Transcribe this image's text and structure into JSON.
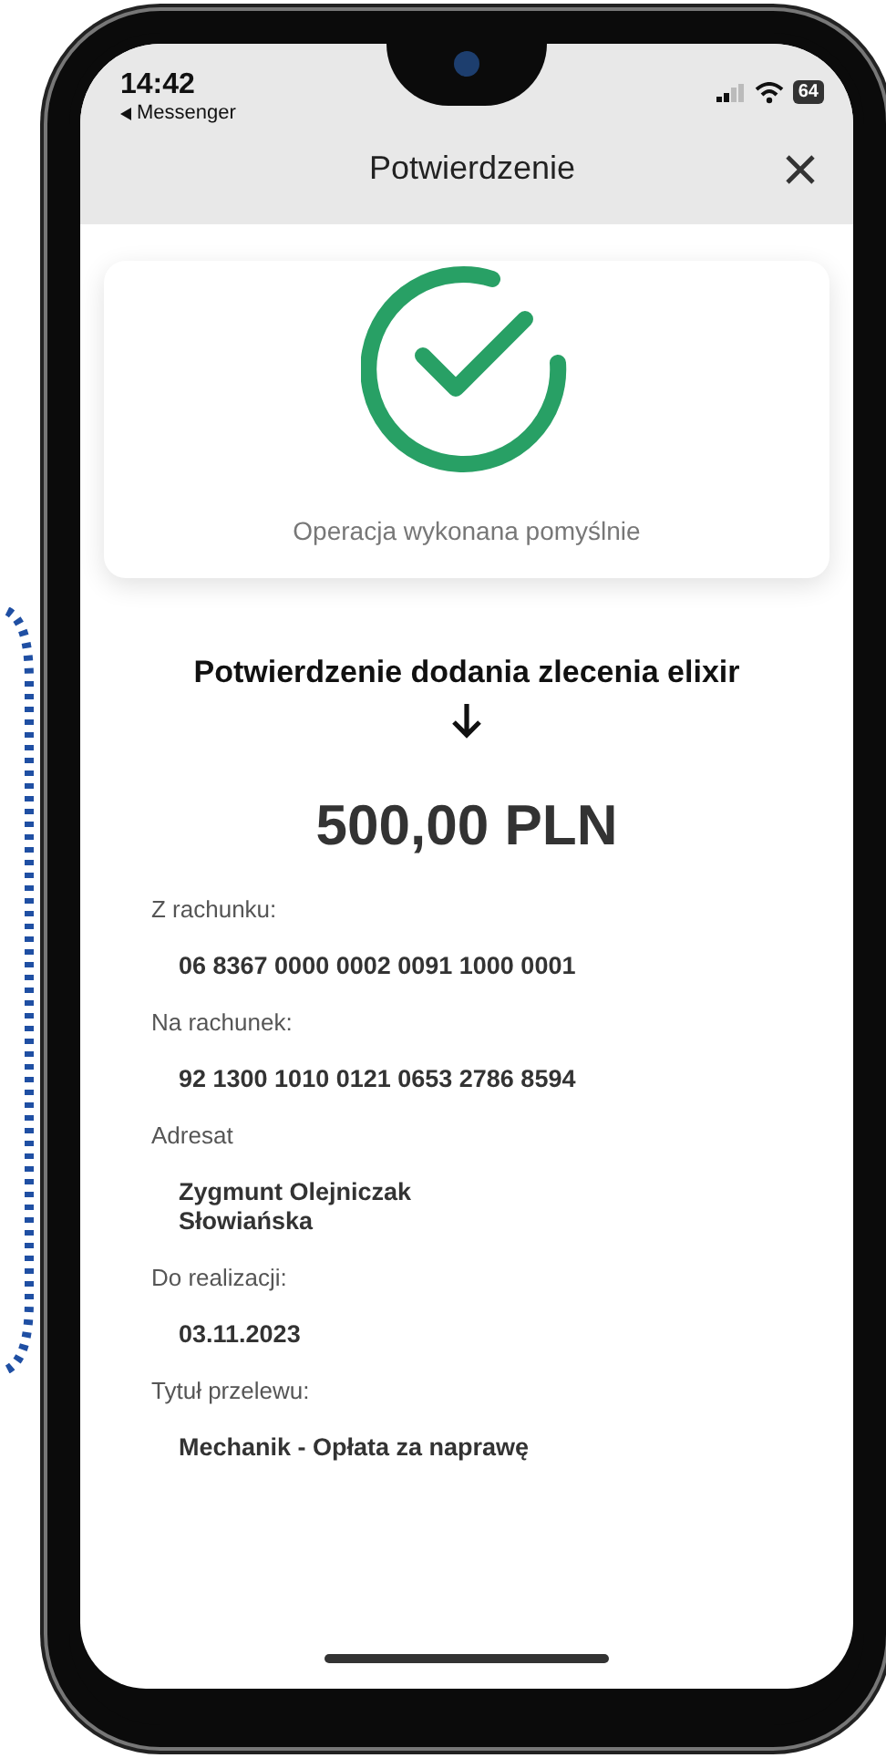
{
  "status_bar": {
    "time": "14:42",
    "back_label": "Messenger",
    "battery": "64"
  },
  "header": {
    "title": "Potwierdzenie"
  },
  "success_card": {
    "message": "Operacja wykonana pomyślnie"
  },
  "transfer": {
    "title": "Potwierdzenie dodania zlecenia elixir",
    "amount": "500,00 PLN",
    "fields": [
      {
        "label": "Z rachunku:",
        "values": [
          "06 8367 0000 0002 0091 1000 0001"
        ]
      },
      {
        "label": "Na rachunek:",
        "values": [
          "92 1300 1010 0121 0653 2786 8594"
        ]
      },
      {
        "label": "Adresat",
        "values": [
          "Zygmunt Olejniczak",
          "Słowiańska"
        ]
      },
      {
        "label": "Do realizacji:",
        "values": [
          "03.11.2023"
        ]
      },
      {
        "label": "Tytuł przelewu:",
        "values": [
          "Mechanik - Opłata za naprawę"
        ]
      }
    ]
  }
}
